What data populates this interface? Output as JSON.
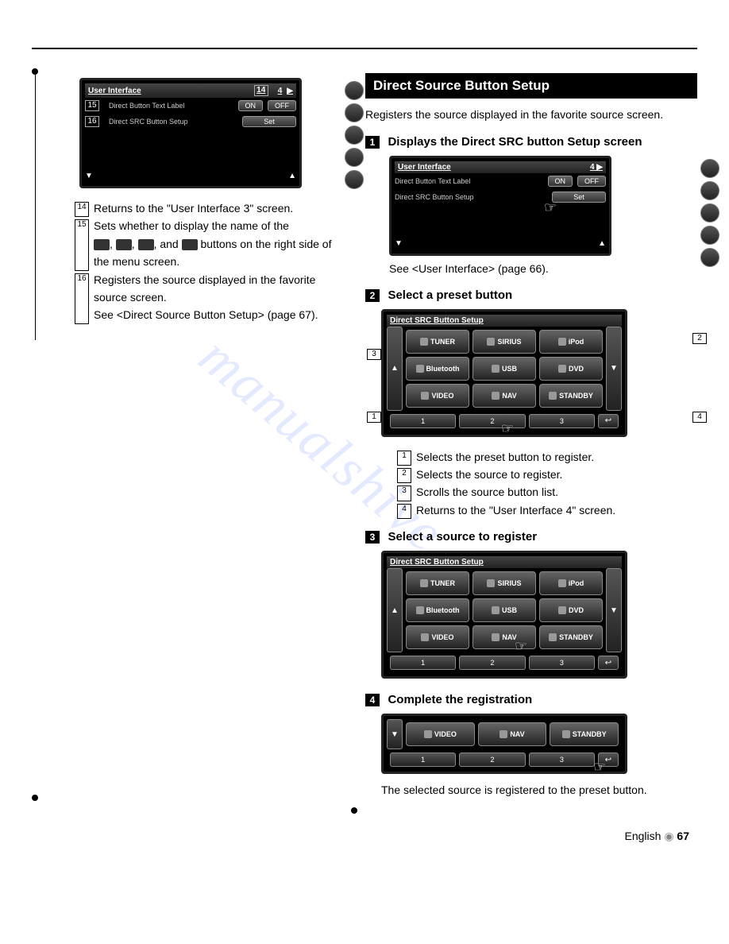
{
  "watermark": "manualshive.com",
  "left": {
    "screen1": {
      "title": "User Interface",
      "page_indicator": "4",
      "tag14": "14",
      "tag15": "15",
      "tag16": "16",
      "row1_label": "Direct Button Text Label",
      "row1_on": "ON",
      "row1_off": "OFF",
      "row2_label": "Direct SRC Button Setup",
      "row2_btn": "Set"
    },
    "items": {
      "n14": "14",
      "n15": "15",
      "n16": "16",
      "t14": "Returns to the \"User Interface 3\" screen.",
      "t15a": "Sets whether to display the name of the",
      "t15b": "buttons on the right side of the menu screen.",
      "t15_and": ", and",
      "t16a": "Registers the source displayed in the favorite source screen.",
      "t16b": "See <Direct Source Button Setup> (page 67)."
    }
  },
  "right": {
    "header": "Direct Source Button Setup",
    "intro": "Registers the source displayed in the favorite source screen.",
    "step1": {
      "num": "1",
      "title": "Displays the Direct SRC button Setup screen",
      "screen": {
        "title": "User Interface",
        "page_indicator": "4",
        "row1_label": "Direct Button Text Label",
        "row1_on": "ON",
        "row1_off": "OFF",
        "row2_label": "Direct SRC Button Setup",
        "row2_btn": "Set"
      },
      "caption": "See <User Interface> (page 66)."
    },
    "step2": {
      "num": "2",
      "title": "Select a preset button",
      "screen": {
        "title": "Direct SRC Button Setup",
        "sources": [
          "TUNER",
          "SIRIUS",
          "iPod",
          "Bluetooth",
          "USB",
          "DVD",
          "VIDEO",
          "NAV",
          "STANDBY"
        ],
        "presets": [
          "1",
          "2",
          "3"
        ],
        "tag1": "1",
        "tag2": "2",
        "tag3": "3",
        "tag4": "4"
      },
      "items": {
        "n1": "1",
        "t1": "Selects the preset button to register.",
        "n2": "2",
        "t2": "Selects the source to register.",
        "n3": "3",
        "t3": "Scrolls the source button list.",
        "n4": "4",
        "t4": "Returns to the \"User Interface 4\" screen."
      }
    },
    "step3": {
      "num": "3",
      "title": "Select a source to register",
      "screen": {
        "title": "Direct SRC Button Setup",
        "sources": [
          "TUNER",
          "SIRIUS",
          "iPod",
          "Bluetooth",
          "USB",
          "DVD",
          "VIDEO",
          "NAV",
          "STANDBY"
        ],
        "presets": [
          "1",
          "2",
          "3"
        ]
      }
    },
    "step4": {
      "num": "4",
      "title": "Complete the registration",
      "screen": {
        "sources_row": [
          "VIDEO",
          "NAV",
          "STANDBY"
        ],
        "presets": [
          "1",
          "2",
          "3"
        ]
      },
      "caption": "The selected source is registered to the preset button."
    }
  },
  "footer": {
    "lang": "English",
    "page": "67"
  }
}
